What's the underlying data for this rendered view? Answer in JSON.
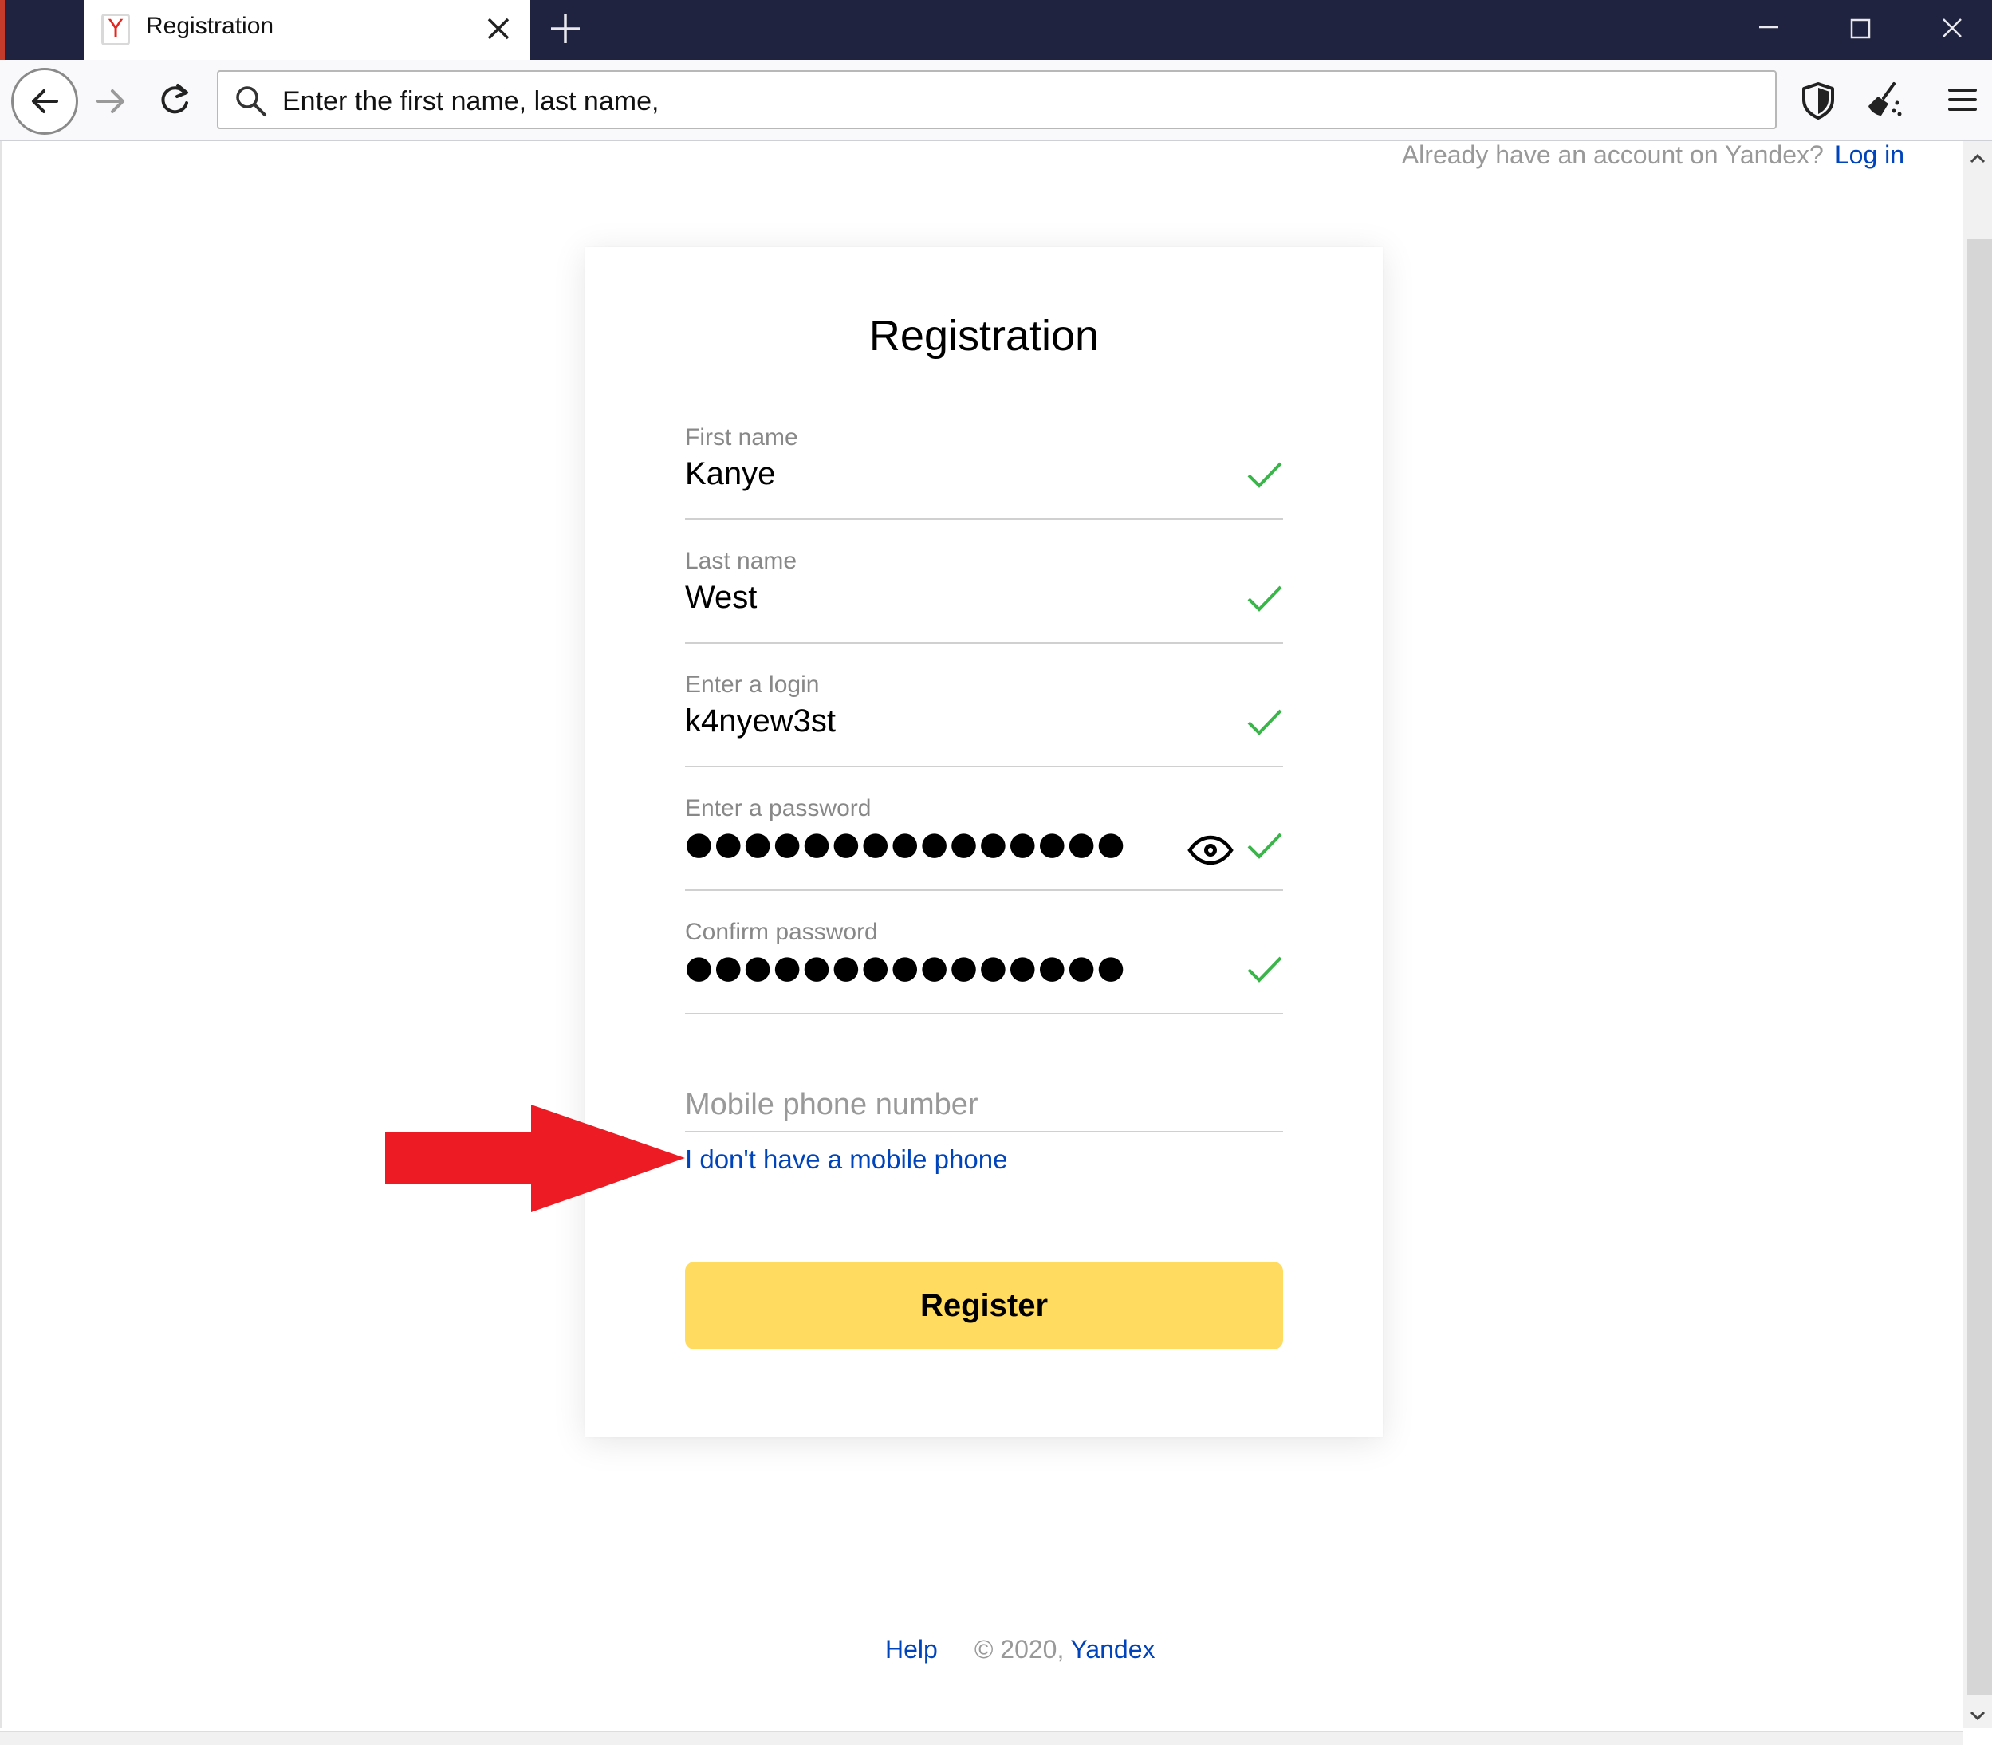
{
  "browser": {
    "tab_title": "Registration",
    "favicon_letter": "Y",
    "url_text": "Enter the first name, last name,"
  },
  "header": {
    "already_text": "Already have an account on Yandex?",
    "login_link": "Log in"
  },
  "form": {
    "title": "Registration",
    "fields": [
      {
        "label": "First name",
        "value": "Kanye",
        "valid": true
      },
      {
        "label": "Last name",
        "value": "West",
        "valid": true
      },
      {
        "label": "Enter a login",
        "value": "k4nyew3st",
        "valid": true
      },
      {
        "label": "Enter a password",
        "value": "●●●●●●●●●●●●●●●",
        "valid": true
      },
      {
        "label": "Confirm password",
        "value": "●●●●●●●●●●●●●●●",
        "valid": true
      }
    ],
    "phone_placeholder": "Mobile phone number",
    "no_phone_link": "I don't have a mobile phone",
    "register_label": "Register"
  },
  "footer": {
    "help": "Help",
    "copyright": "© 2020,",
    "brand": "Yandex"
  },
  "colors": {
    "accent_link": "#0044bb",
    "button_yellow": "#ffdb60",
    "check_green": "#3ab54a",
    "arrow_red": "#ed1c24",
    "tabbar_dark": "#20233f"
  },
  "icons": [
    "back-arrow-icon",
    "forward-arrow-icon",
    "reload-icon",
    "search-icon",
    "shield-icon",
    "broom-icon",
    "hamburger-menu-icon",
    "close-icon",
    "plus-icon",
    "minimize-icon",
    "maximize-icon",
    "check-icon",
    "eye-icon",
    "red-arrow-pointer"
  ]
}
